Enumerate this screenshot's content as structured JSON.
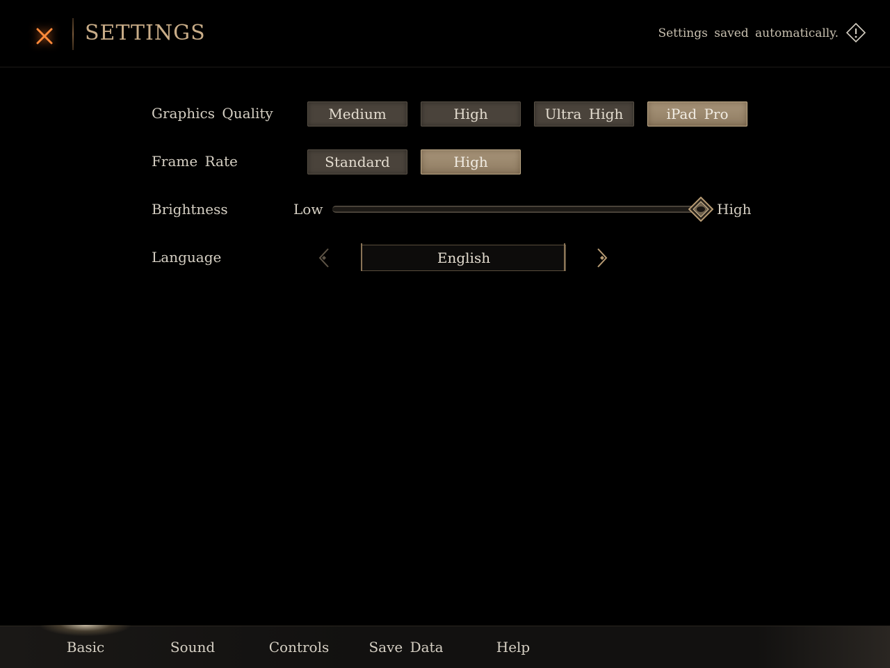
{
  "header": {
    "title": "SETTINGS",
    "notice": "Settings saved automatically.",
    "close_icon": "close-x-icon",
    "notice_icon": "info-diamond-icon"
  },
  "settings": {
    "graphics": {
      "label": "Graphics Quality",
      "options": [
        "Medium",
        "High",
        "Ultra High",
        "iPad Pro"
      ],
      "selected": "iPad Pro"
    },
    "frame_rate": {
      "label": "Frame Rate",
      "options": [
        "Standard",
        "High"
      ],
      "selected": "High"
    },
    "brightness": {
      "label": "Brightness",
      "min_label": "Low",
      "max_label": "High",
      "value": 1.0
    },
    "language": {
      "label": "Language",
      "value": "English"
    }
  },
  "tabs": [
    "Basic",
    "Sound",
    "Controls",
    "Save Data",
    "Help"
  ],
  "active_tab": "Basic",
  "colors": {
    "accent": "#c9ad88",
    "close_glow": "#ff7a2a",
    "selected_button": "#a8957a",
    "button": "#4a433b"
  }
}
